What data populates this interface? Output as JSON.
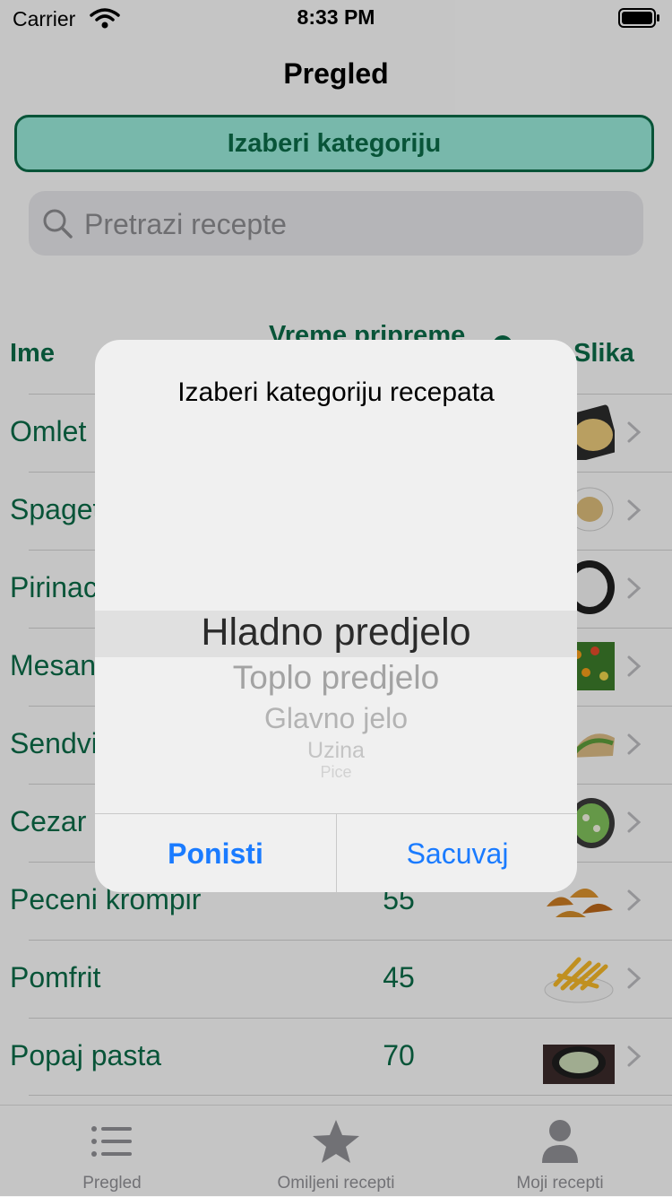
{
  "status": {
    "carrier": "Carrier",
    "time": "8:33 PM"
  },
  "nav": {
    "title": "Pregled"
  },
  "category_button": {
    "label": "Izaberi kategoriju"
  },
  "search": {
    "placeholder": "Pretrazi recepte"
  },
  "table": {
    "headers": {
      "name": "Ime",
      "time": "Vreme pripreme",
      "image": "Slika"
    },
    "rows": [
      {
        "name": "Omlet",
        "time": "",
        "thumb": "omlet"
      },
      {
        "name": "Spageti",
        "time": "",
        "thumb": "spageti"
      },
      {
        "name": "Pirinac",
        "time": "",
        "thumb": "pirinac"
      },
      {
        "name": "Mesano povrce",
        "time": "",
        "thumb": "povrce"
      },
      {
        "name": "Sendvic",
        "time": "",
        "thumb": "sendvic"
      },
      {
        "name": "Cezar salata",
        "time": "",
        "thumb": "salata"
      },
      {
        "name": "Peceni krompir",
        "time": "55",
        "thumb": "krompir"
      },
      {
        "name": "Pomfrit",
        "time": "45",
        "thumb": "pomfrit"
      },
      {
        "name": "Popaj pasta",
        "time": "70",
        "thumb": "pasta"
      }
    ]
  },
  "dialog": {
    "title": "Izaberi kategoriju recepata",
    "picker": [
      "Hladno predjelo",
      "Toplo predjelo",
      "Glavno jelo",
      "Uzina",
      "Pice"
    ],
    "cancel": "Ponisti",
    "save": "Sacuvaj"
  },
  "tabs": [
    {
      "label": "Pregled",
      "icon": "list-icon"
    },
    {
      "label": "Omiljeni recepti",
      "icon": "star-icon"
    },
    {
      "label": "Moji recepti",
      "icon": "person-icon"
    }
  ],
  "colors": {
    "accent": "#0b6a47",
    "button_fill": "#96e6d6",
    "link": "#1a7bff"
  }
}
